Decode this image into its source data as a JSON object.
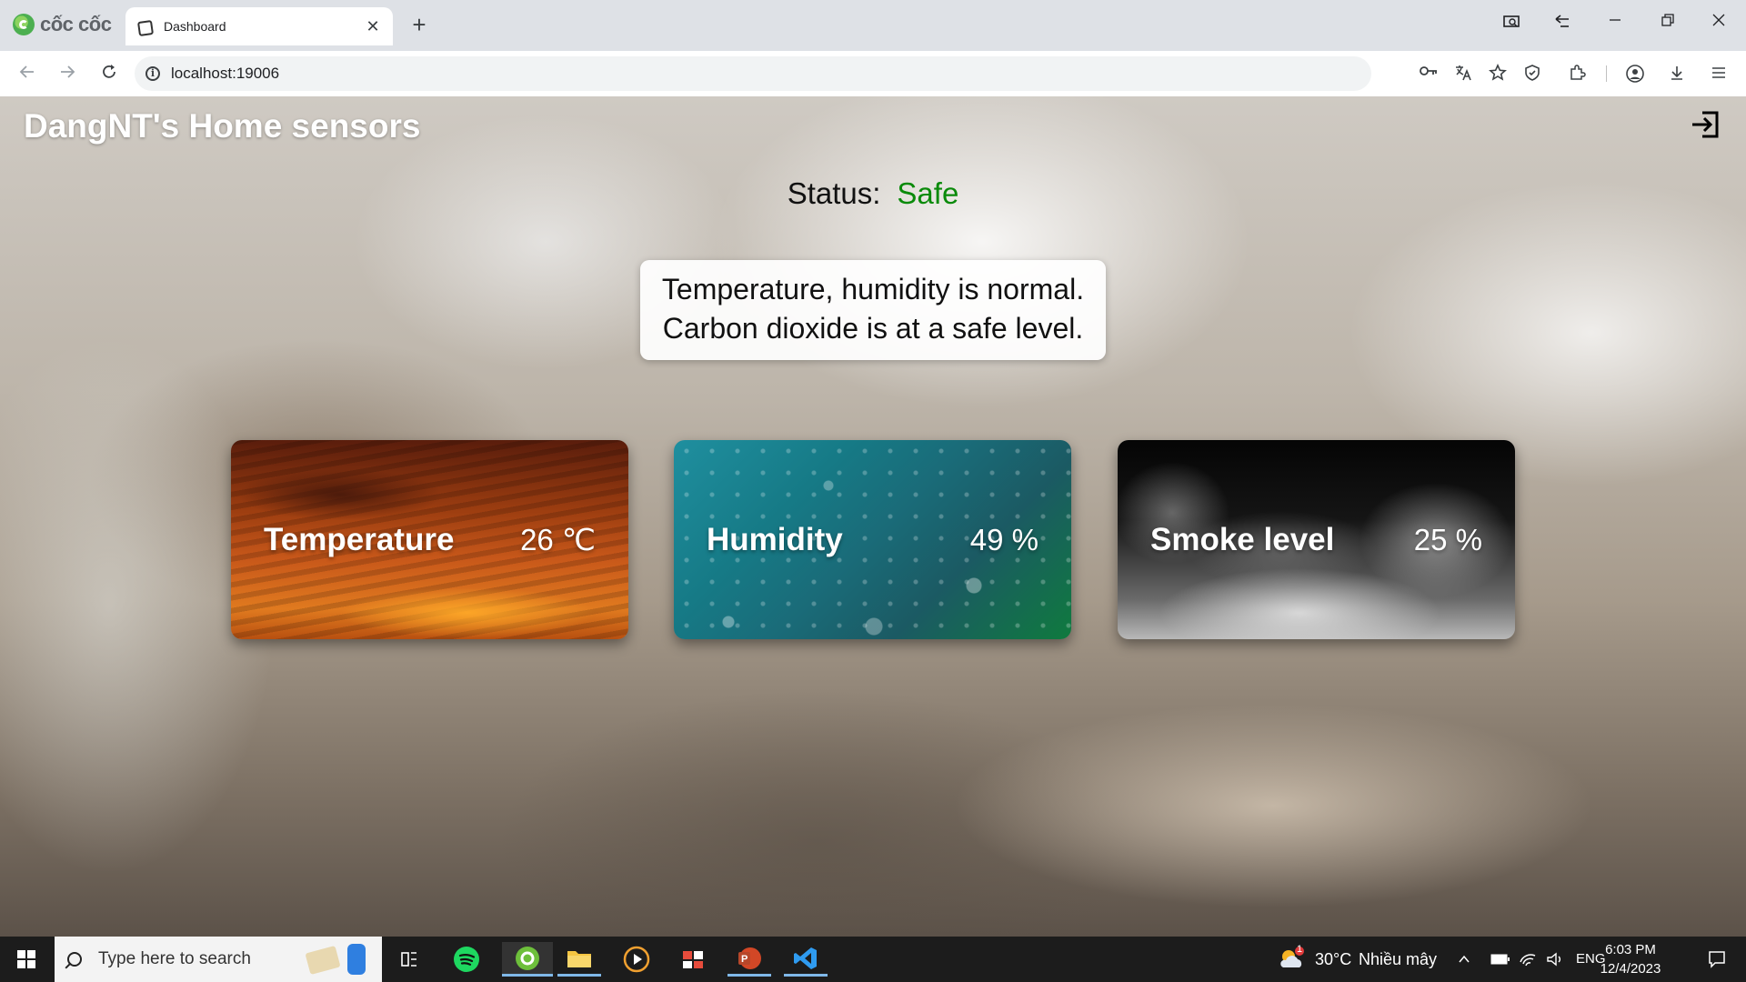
{
  "browser": {
    "brand": "cốc cốc",
    "tab_title": "Dashboard",
    "tab_close": "✕",
    "new_tab": "+",
    "url": "localhost:19006"
  },
  "page": {
    "title": "DangNT's Home sensors",
    "status_label": "Status:",
    "status_value": "Safe",
    "status_color": "#0a8a0a",
    "message_line1": "Temperature, humidity is normal.",
    "message_line2": "Carbon dioxide is at a safe level.",
    "cards": [
      {
        "label": "Temperature",
        "value": "26 ℃"
      },
      {
        "label": "Humidity",
        "value": "49 %"
      },
      {
        "label": "Smoke level",
        "value": "25 %"
      }
    ]
  },
  "taskbar": {
    "search_placeholder": "Type here to search",
    "weather_temp": "30°C",
    "weather_desc": "Nhiều mây",
    "language": "ENG",
    "time": "6:03 PM",
    "date": "12/4/2023",
    "weather_badge": "1"
  },
  "icons": [
    "coccoc-logo-icon",
    "tab-favicon-icon",
    "screen-capture-icon",
    "back-forward-icon",
    "minimize-icon",
    "restore-icon",
    "close-icon",
    "back-arrow-icon",
    "forward-arrow-icon",
    "reload-icon",
    "info-icon",
    "key-icon",
    "translate-icon",
    "star-icon",
    "shield-icon",
    "extensions-icon",
    "profile-icon",
    "download-icon",
    "menu-icon",
    "logout-icon",
    "windows-start-icon",
    "search-icon",
    "task-view-icon",
    "spotify-icon",
    "coccoc-taskbar-icon",
    "file-explorer-icon",
    "media-player-icon",
    "snipping-icon",
    "powerpoint-icon",
    "vscode-icon",
    "weather-icon",
    "chevron-up-icon",
    "battery-icon",
    "wifi-icon",
    "volume-icon",
    "notification-icon"
  ]
}
